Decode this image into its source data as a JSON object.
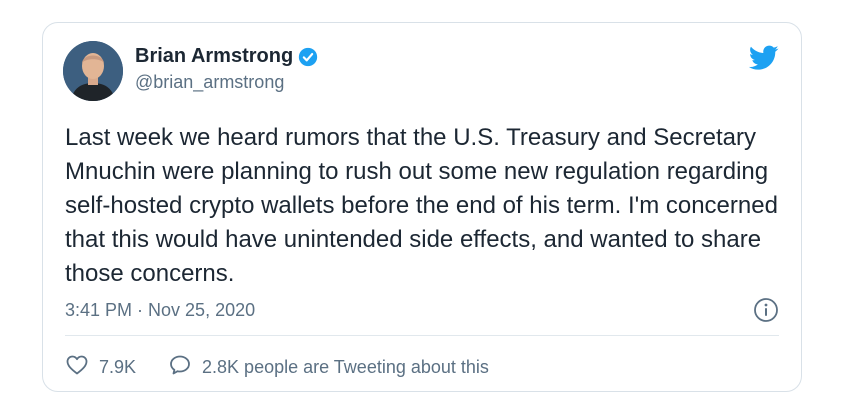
{
  "tweet": {
    "author": {
      "display_name": "Brian Armstrong",
      "handle": "@brian_armstrong",
      "verified": true
    },
    "text": "Last week we heard rumors that the U.S. Treasury and Secretary Mnuchin were planning to rush out some new regulation regarding self-hosted crypto wallets before the end of his term. I'm concerned that this would have unintended side effects, and wanted to share those concerns.",
    "timestamp": "3:41 PM · Nov 25, 2020",
    "likes": "7.9K",
    "conversation": "2.8K people are Tweeting about this"
  },
  "icons": {
    "brand": "twitter-bird-icon",
    "verified": "verified-badge-icon",
    "info": "info-icon",
    "like": "heart-icon",
    "reply": "speech-bubble-icon"
  },
  "colors": {
    "brand": "#1da1f2",
    "text": "#1c2733",
    "secondary": "#5b7083",
    "border": "#d9e1e8"
  }
}
